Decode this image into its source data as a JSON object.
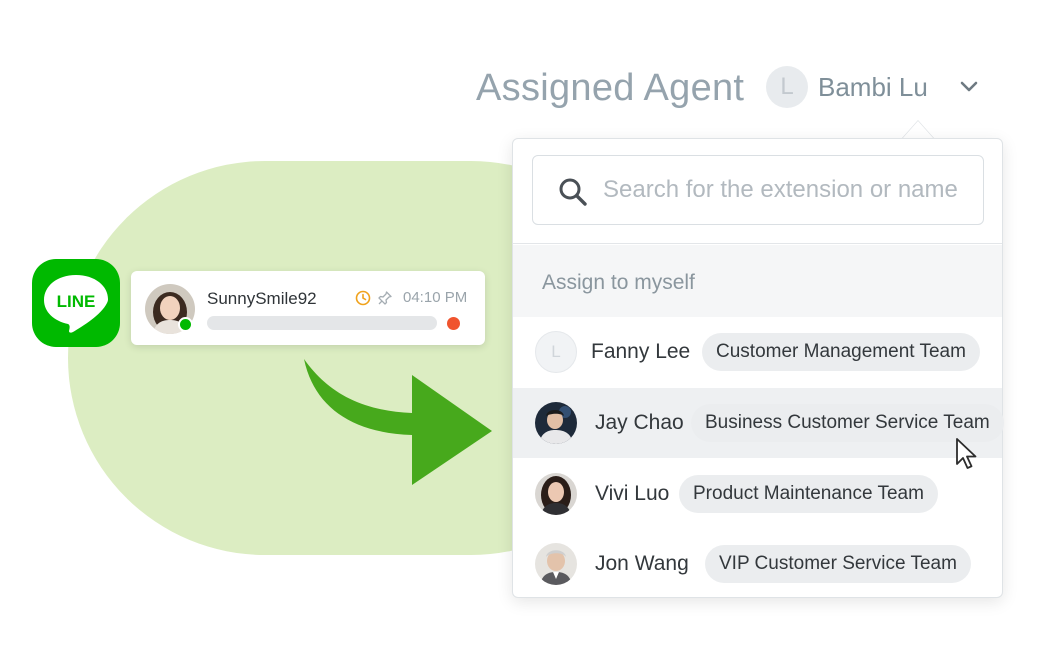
{
  "header": {
    "title": "Assigned Agent",
    "agent_initial": "L",
    "agent_name": "Bambi Lu",
    "chevron_icon": "chevron-down-icon"
  },
  "line_logo": {
    "text": "LINE",
    "color": "#00b900"
  },
  "chat_card": {
    "username": "SunnySmile92",
    "time": "04:10 PM",
    "icons": [
      "clock-icon",
      "pin-icon"
    ],
    "unread_dot_color": "#f0542e"
  },
  "dropdown": {
    "search": {
      "placeholder": "Search for the extension or name",
      "value": ""
    },
    "assign_self_label": "Assign to myself",
    "agents": [
      {
        "name": "Fanny Lee",
        "team": "Customer Management Team",
        "avatar_letter": "L",
        "hovered": false
      },
      {
        "name": "Jay Chao",
        "team": "Business Customer Service Team",
        "hovered": true
      },
      {
        "name": "Vivi Luo",
        "team": "Product Maintenance Team",
        "hovered": false
      },
      {
        "name": "Jon Wang",
        "team": "VIP Customer Service Team",
        "hovered": false
      }
    ]
  },
  "colors": {
    "accent_green": "#00b900",
    "arrow_green": "#47a91c",
    "background_blob": "#dcedc2"
  }
}
